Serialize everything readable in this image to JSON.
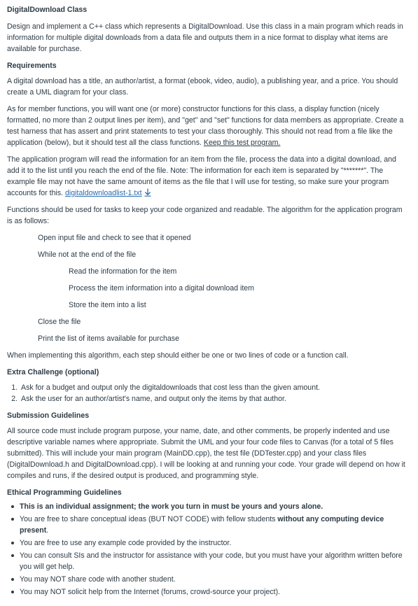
{
  "title": "DigitalDownload Class",
  "intro": "Design and implement a C++ class which represents a DigitalDownload.  Use this class in a main program which reads in information for multiple digital downloads from a data file and outputs them in a nice format to display what items are available for purchase.",
  "requirements_heading": "Requirements",
  "req_p1": "A digital download has a title, an author/artist, a format (ebook, video, audio), a publishing year, and a price. You should create a UML diagram for your class.",
  "req_p2_text": "As for member functions, you will want one (or more) constructor functions for this class, a display function (nicely formatted, no more than 2 output lines per item), and \"get\" and \"set\" functions for data members as appropriate.  Create a test harness that has assert and print statements to test your class thoroughly.  This should not read from a file like the application (below), but it should test all the class functions.  ",
  "req_p2_link": "Keep this test program.",
  "req_p3_text": "The application program will read the information for an item from the file, process the data into a digital download, and add it to the list until you reach the end of the file.  Note:  The information for each item is separated by \"*******\". The example file may not have the same amount of items as the file that I will use for testing, so make sure your program accounts for this. ",
  "req_p3_link": "digitaldownloadlist-1.txt",
  "req_p4": "Functions should be used for tasks to keep your code organized and readable.  The algorithm for the application program is as follows:",
  "algorithm": {
    "s1": "Open input file and check to see that it opened",
    "s2": "While not at the end of the file",
    "s3": "Read the information for the item",
    "s4": "Process the item information into a digital download item",
    "s5": "Store the item into a list",
    "s6": "Close the file",
    "s7": "Print the list of items available for purchase"
  },
  "after_algorithm": "When implementing this algorithm, each step should either be one or two lines of code or a function call.",
  "extra_heading": "Extra Challenge (optional)",
  "extra_items": [
    "Ask for a budget and output only the digitaldownloads that cost less than the given amount.",
    "Ask the user for an author/artist's name, and output only the items by that author."
  ],
  "submission_heading": "Submission Guidelines",
  "submission_text": "All source code must include program purpose, your name, date, and other comments, be properly indented and use descriptive variable names where appropriate. Submit the UML and your four code files to Canvas (for a total of 5 files submitted).  This will include your main program (MainDD.cpp), the test file (DDTester.cpp) and your class files (DigitalDownload.h and DigitalDownload.cpp).  I will be looking at and running your code.  Your grade will depend on how it compiles and runs, if the desired output is produced, and programming style.",
  "ethics_heading": "Ethical Programming Guidelines",
  "ethics": {
    "i1": "This is an individual assignment; the work you turn in must be yours and yours alone.",
    "i2_a": "You are free to share conceptual ideas (BUT NOT CODE) with fellow students ",
    "i2_b": "without any computing device present",
    "i2_c": ".",
    "i3": "You are free to use any example code provided by the instructor.",
    "i4": "You can consult SIs and the instructor for assistance with your code, but you must have your algorithm written before you will get help.",
    "i5": "You may NOT share code with another student.",
    "i6": "You may NOT solicit help from the Internet (forums, crowd-source your project)."
  },
  "colors": {
    "text": "#2d3b45",
    "link": "#2b6cb0"
  },
  "icons": {
    "download": "download-icon"
  }
}
